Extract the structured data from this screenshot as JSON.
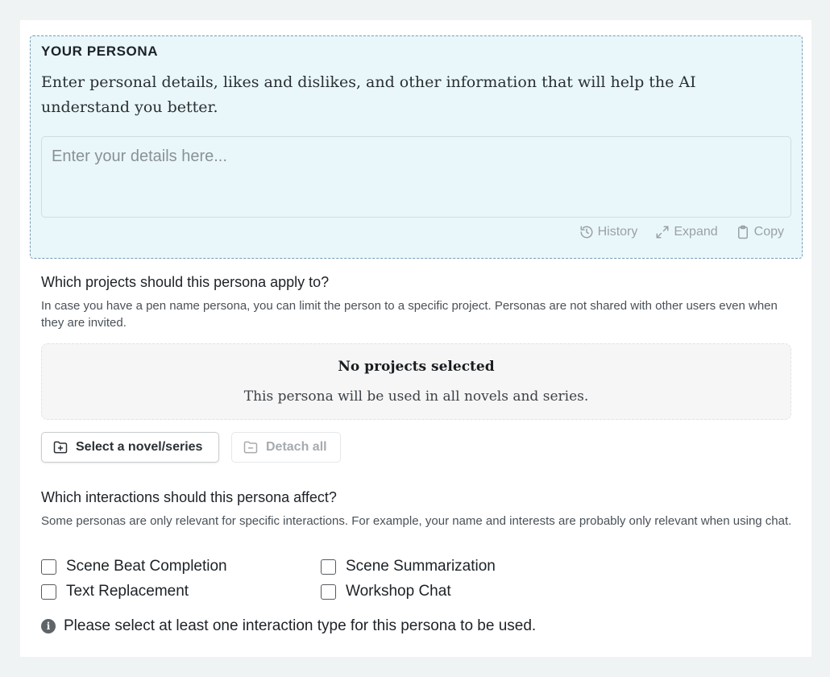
{
  "persona": {
    "title": "YOUR PERSONA",
    "description": "Enter personal details, likes and dislikes, and other information that will help the AI understand you better.",
    "input_value": "",
    "input_placeholder": "Enter your details here...",
    "tools": {
      "history": {
        "label": "History",
        "icon": "history-icon"
      },
      "expand": {
        "label": "Expand",
        "icon": "expand-icon"
      },
      "copy": {
        "label": "Copy",
        "icon": "clipboard-icon"
      }
    }
  },
  "projects": {
    "title": "Which projects should this persona apply to?",
    "help": "In case you have a pen name persona, you can limit the person to a specific project. Personas are not shared with other users even when they are invited.",
    "empty_title": "No projects selected",
    "empty_desc": "This persona will be used in all novels and series.",
    "select_button": "Select a novel/series",
    "detach_button": "Detach all"
  },
  "interactions": {
    "title": "Which interactions should this persona affect?",
    "help": "Some personas are only relevant for specific interactions. For example, your name and interests are probably only relevant when using chat.",
    "options": [
      {
        "label": "Scene Beat Completion",
        "checked": false
      },
      {
        "label": "Scene Summarization",
        "checked": false
      },
      {
        "label": "Text Replacement",
        "checked": false
      },
      {
        "label": "Workshop Chat",
        "checked": false
      }
    ],
    "notice": "Please select at least one interaction type for this persona to be used."
  },
  "colors": {
    "persona_bg": "#e9f7fb",
    "persona_border": "#7a9bb4",
    "page_bg": "#eff3f3"
  }
}
